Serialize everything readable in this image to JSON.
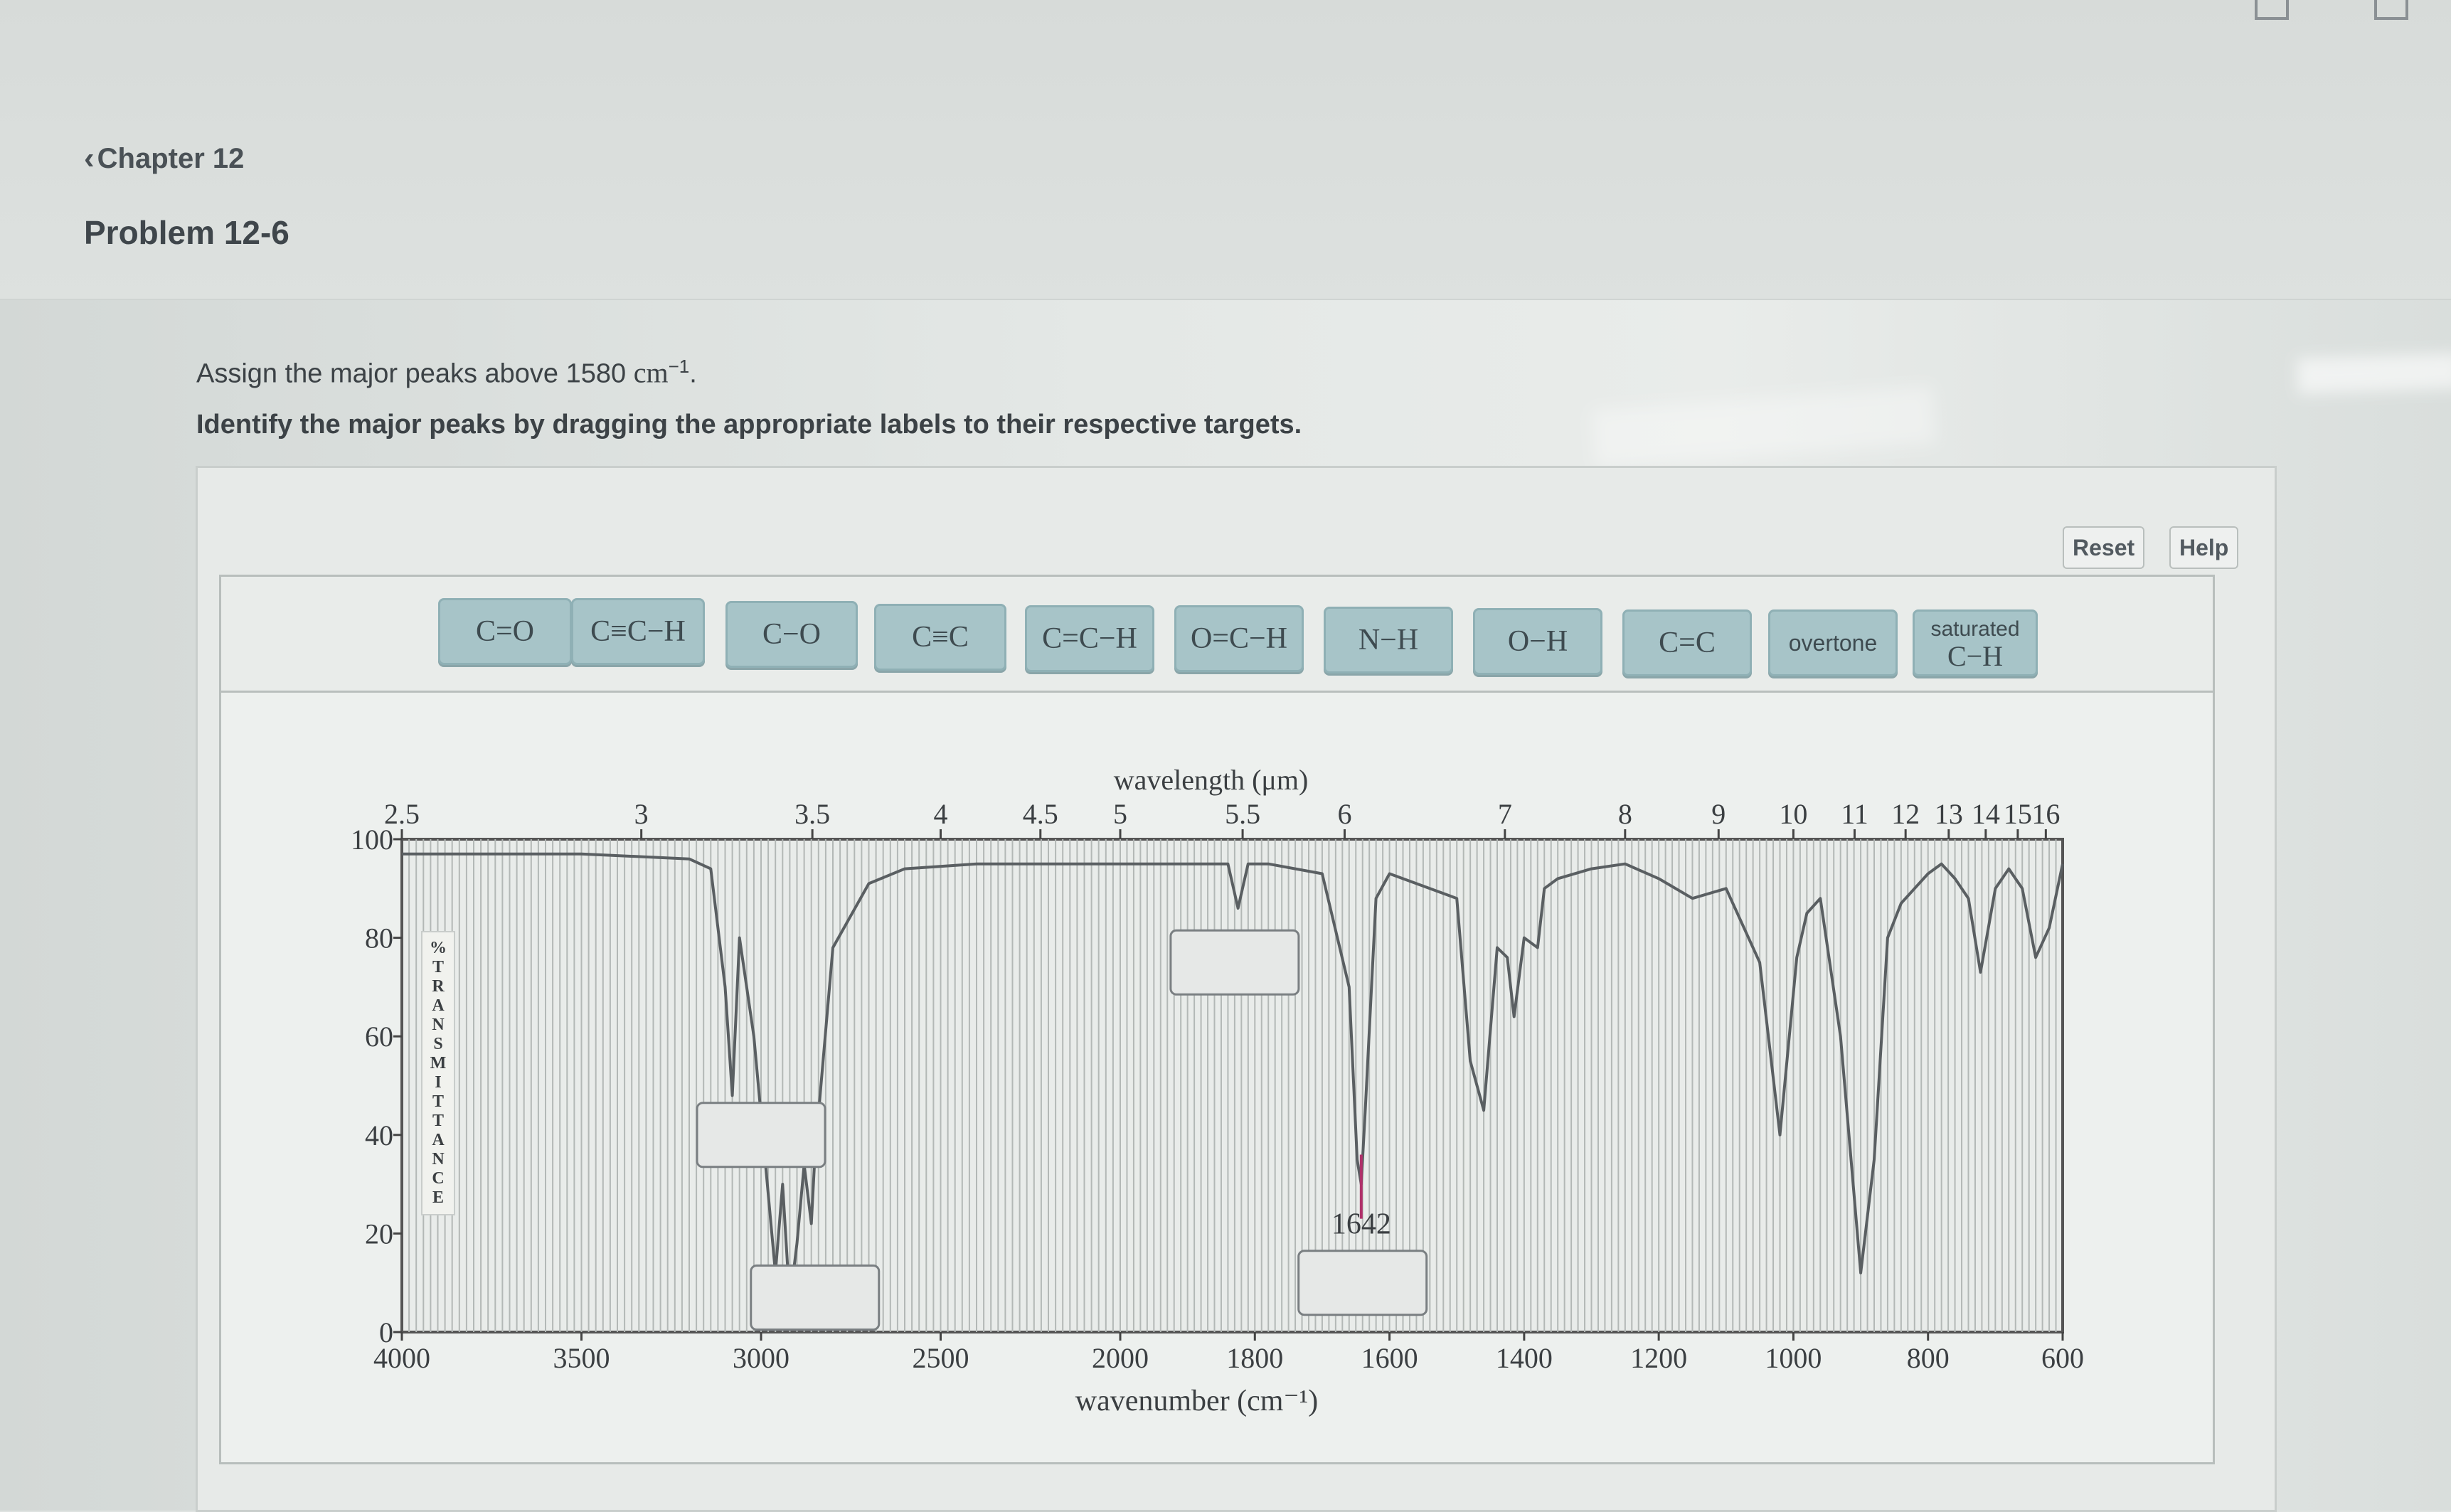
{
  "nav": {
    "back_label": "Chapter 12",
    "back_icon": "chevron-left-icon"
  },
  "problem": {
    "title": "Problem 12-6",
    "prompt_text": "Assign the major peaks above 1580",
    "prompt_unit": "cm",
    "prompt_exponent": "−1",
    "prompt_end": ".",
    "instruction": "Identify the major peaks by dragging the appropriate labels to their respective targets."
  },
  "toolbar": {
    "reset_label": "Reset",
    "help_label": "Help"
  },
  "labels": [
    {
      "id": "co-double",
      "text": "C=O"
    },
    {
      "id": "alkyne-ch",
      "text": "C≡C−H"
    },
    {
      "id": "co-single",
      "text": "C−O"
    },
    {
      "id": "cc-triple",
      "text": "C≡C"
    },
    {
      "id": "vinyl-ch",
      "text": "C=C−H"
    },
    {
      "id": "aldehyde-ch",
      "text": "O=C−H"
    },
    {
      "id": "nh",
      "text": "N−H"
    },
    {
      "id": "oh",
      "text": "O−H"
    },
    {
      "id": "cc-double",
      "text": "C=C"
    },
    {
      "id": "overtone",
      "text": "overtone"
    },
    {
      "id": "sat-ch",
      "text_line1": "saturated",
      "text_line2": "C−H"
    }
  ],
  "chart_data": {
    "type": "line",
    "title": "",
    "xlabel": "wavenumber (cm⁻¹)",
    "ylabel": "%TRANSMITTANCE",
    "top_axis_label": "wavelength (μm)",
    "ylim": [
      0,
      100
    ],
    "y_ticks": [
      "0",
      "20",
      "40",
      "60",
      "80",
      "100"
    ],
    "x_ticks": [
      "4000",
      "3500",
      "3000",
      "2500",
      "2000",
      "1800",
      "1600",
      "1400",
      "1200",
      "1000",
      "800",
      "600"
    ],
    "top_ticks": [
      "2.5",
      "3",
      "3.5",
      "4",
      "4.5",
      "5",
      "5.5",
      "6",
      "7",
      "8",
      "9",
      "10",
      "11",
      "12",
      "13",
      "14",
      "15",
      "16"
    ],
    "annotations": [
      {
        "text": "1642",
        "x": 1642,
        "color": "#b0306a"
      }
    ],
    "series": [
      {
        "x": [
          4000,
          3800,
          3500,
          3200,
          3140,
          3100,
          3080,
          3060,
          3020,
          2980,
          2960,
          2940,
          2920,
          2900,
          2880,
          2860,
          2850,
          2800,
          2700,
          2600,
          2400,
          2000,
          1840,
          1825,
          1810,
          1780,
          1700,
          1660,
          1648,
          1642,
          1636,
          1620,
          1600,
          1500,
          1480,
          1460,
          1440,
          1425,
          1415,
          1400,
          1380,
          1370,
          1350,
          1300,
          1250,
          1200,
          1150,
          1100,
          1050,
          1020,
          995,
          980,
          960,
          930,
          900,
          880,
          860,
          840,
          820,
          800,
          780,
          760,
          740,
          722,
          700,
          680,
          660,
          640,
          620,
          600
        ],
        "y": [
          97,
          97,
          97,
          96,
          94,
          70,
          48,
          80,
          60,
          28,
          12,
          30,
          6,
          18,
          34,
          22,
          36,
          78,
          91,
          94,
          95,
          95,
          95,
          86,
          95,
          95,
          93,
          70,
          35,
          30,
          45,
          88,
          93,
          88,
          55,
          45,
          78,
          76,
          64,
          80,
          78,
          90,
          92,
          94,
          95,
          92,
          88,
          90,
          75,
          40,
          76,
          85,
          88,
          60,
          12,
          35,
          80,
          87,
          90,
          93,
          95,
          92,
          88,
          73,
          90,
          94,
          90,
          76,
          82,
          95
        ]
      }
    ],
    "targets": [
      {
        "x": 3000,
        "y": 40
      },
      {
        "x": 2850,
        "y": 7
      },
      {
        "x": 1830,
        "y": 75
      },
      {
        "x": 1640,
        "y": 10
      }
    ]
  }
}
